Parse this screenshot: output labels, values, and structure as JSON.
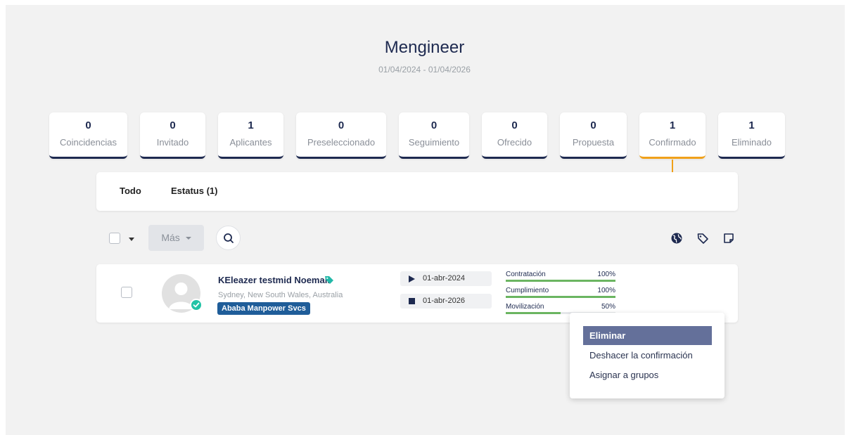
{
  "header": {
    "title": "Mengineer",
    "dates": "01/04/2024 - 01/04/2026"
  },
  "stages": [
    {
      "count": "0",
      "label": "Coincidencias"
    },
    {
      "count": "0",
      "label": "Invitado"
    },
    {
      "count": "1",
      "label": "Aplicantes"
    },
    {
      "count": "0",
      "label": "Preseleccionado"
    },
    {
      "count": "0",
      "label": "Seguimiento"
    },
    {
      "count": "0",
      "label": "Ofrecido"
    },
    {
      "count": "0",
      "label": "Propuesta"
    },
    {
      "count": "1",
      "label": "Confirmado"
    },
    {
      "count": "1",
      "label": "Eliminado"
    }
  ],
  "active_stage": "Confirmado",
  "filters": {
    "all": "Todo",
    "status": "Estatus (1)"
  },
  "toolbar": {
    "more_label": "Más"
  },
  "candidate": {
    "name": "KEleazer testmid Noemail",
    "location": "Sydney, New South Wales, Australia",
    "company": "Ababa Manpower Svcs",
    "start_date": "01-abr-2024",
    "end_date": "01-abr-2026",
    "progress": [
      {
        "label": "Contratación",
        "pct": "100%",
        "value": 100
      },
      {
        "label": "Cumplimiento",
        "pct": "100%",
        "value": 100
      },
      {
        "label": "Movilización",
        "pct": "50%",
        "value": 50
      }
    ]
  },
  "context_menu": {
    "items": [
      "Eliminar",
      "Deshacer la confirmación",
      "Asignar a grupos"
    ],
    "highlighted": "Eliminar"
  },
  "colors": {
    "accent": "#f0a11a",
    "navy": "#1e2a50",
    "progress": "#6bb561",
    "badge": "#1f5d99",
    "verified": "#22c3a6",
    "menu_highlight": "#64709a"
  }
}
